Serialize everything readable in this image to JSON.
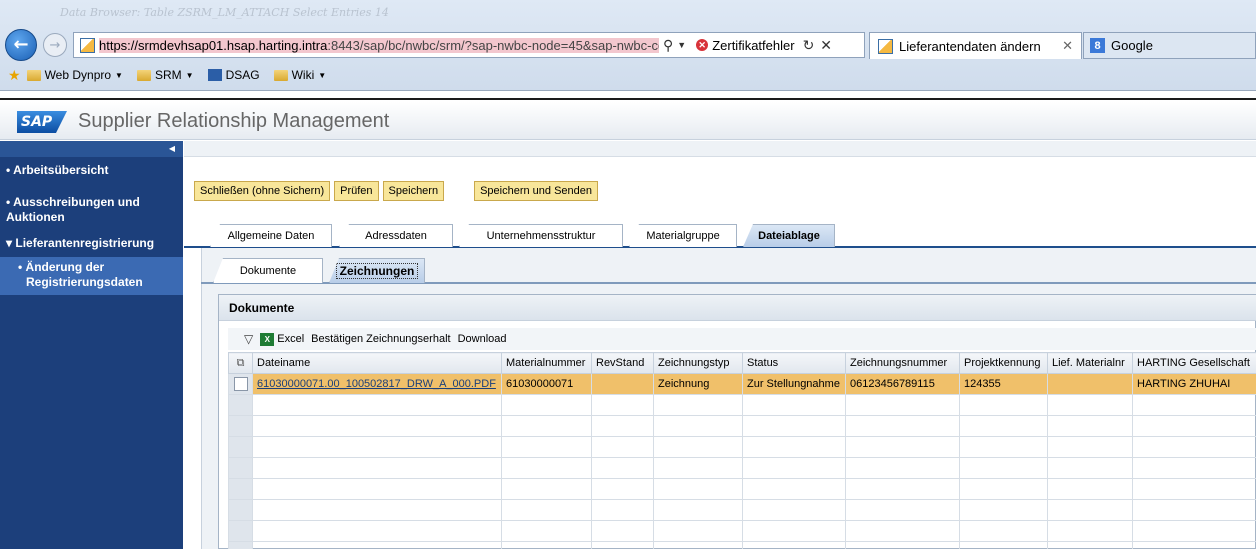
{
  "browser": {
    "ghost_title": "Data Browser: Table ZSRM_LM_ATTACH Select Entries   14",
    "url_host": "https://srmdevhsap01.hsap.harting.intra",
    "url_rest": ":8443/sap/bc/nwbc/srm/?sap-nwbc-node=45&sap-nwbc-context=(",
    "cert_error": "Zertifikatfehler",
    "active_tab": "Lieferantendaten ändern",
    "other_tab": "Google",
    "favorites": [
      "Web Dynpro",
      "SRM",
      "DSAG",
      "Wiki"
    ]
  },
  "app": {
    "title": "Supplier Relationship Management",
    "logo": "SAP"
  },
  "sidebar": {
    "items": [
      {
        "label": "Arbeitsübersicht",
        "prefix": "•"
      },
      {
        "label": "Ausschreibungen und Auktionen",
        "prefix": "•"
      },
      {
        "label": "Lieferantenregistrierung",
        "prefix": "▾"
      },
      {
        "label": "Änderung der Registrierungsdaten",
        "prefix": "•"
      }
    ]
  },
  "toolbar": {
    "close_label": "Schließen (ohne Sichern)",
    "check_label": "Prüfen",
    "save_label": "Speichern",
    "save_send_label": "Speichern und Senden"
  },
  "main_tabs": [
    "Allgemeine Daten",
    "Adressdaten",
    "Unternehmensstruktur",
    "Materialgruppe",
    "Dateiablage"
  ],
  "active_main_tab": "Dateiablage",
  "sub_tabs": [
    "Dokumente",
    "Zeichnungen"
  ],
  "active_sub_tab": "Zeichnungen",
  "group_title": "Dokumente",
  "table_toolbar": {
    "excel": "Excel",
    "confirm": "Bestätigen Zeichnungserhalt",
    "download": "Download"
  },
  "table": {
    "columns": [
      "Dateiname",
      "Materialnummer",
      "RevStand",
      "Zeichnungstyp",
      "Status",
      "Zeichnungsnummer",
      "Projektkennung",
      "Lief. Materialnr",
      "HARTING Gesellschaft"
    ],
    "rows": [
      [
        "61030000071.00_100502817_DRW_A_000.PDF",
        "61030000071",
        "",
        "Zeichnung",
        "Zur Stellungnahme",
        "06123456789115",
        "124355",
        "",
        "HARTING ZHUHAI"
      ]
    ]
  }
}
